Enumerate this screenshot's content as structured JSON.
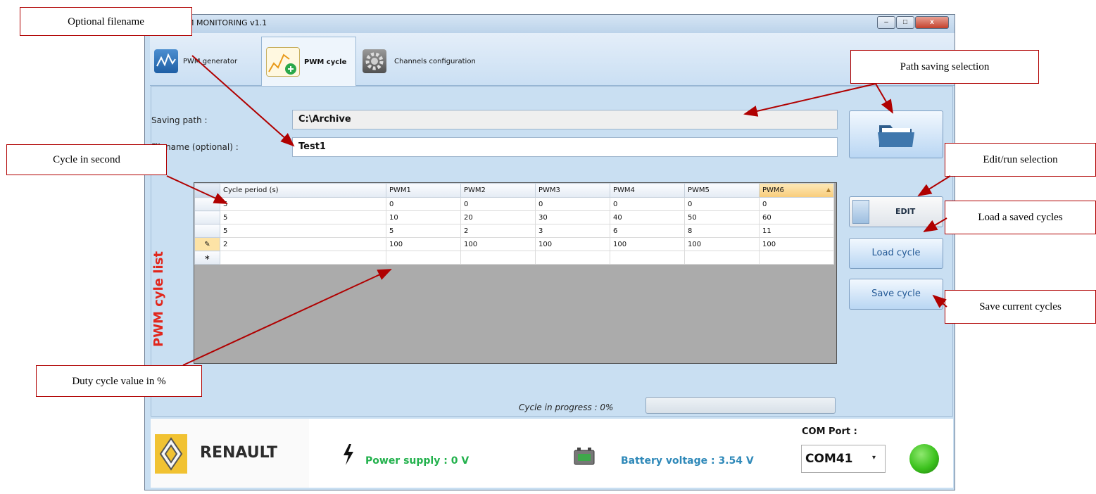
{
  "window": {
    "title": "M MONITORING v1.1",
    "controls": {
      "minimize": "–",
      "maximize": "□",
      "close": "x"
    }
  },
  "tabs": [
    {
      "label": "PWM generator",
      "icon": "waveform-icon"
    },
    {
      "label": "PWM cycle",
      "icon": "chart-add-icon",
      "active": true
    },
    {
      "label": "Channels configuration",
      "icon": "gear-icon"
    }
  ],
  "form": {
    "saving_path_label": "Saving path :",
    "saving_path_value": "C:\\Archive",
    "filename_label": "Filename (optional) :",
    "filename_value": "Test1"
  },
  "side_buttons": {
    "folder": "folder-icon",
    "edit": "EDIT",
    "load": "Load cycle",
    "save": "Save cycle"
  },
  "section_label": "PWM cyle list",
  "table": {
    "columns": [
      "Cycle period (s)",
      "PWM1",
      "PWM2",
      "PWM3",
      "PWM4",
      "PWM5",
      "PWM6"
    ],
    "rows": [
      [
        "5",
        "0",
        "0",
        "0",
        "0",
        "0",
        "0"
      ],
      [
        "5",
        "10",
        "20",
        "30",
        "40",
        "50",
        "60"
      ],
      [
        "5",
        "5",
        "2",
        "3",
        "6",
        "8",
        "11"
      ],
      [
        "2",
        "100",
        "100",
        "100",
        "100",
        "100",
        "100"
      ]
    ],
    "new_row_marker": "∗",
    "edit_row_marker": "✎"
  },
  "progress": {
    "label": "Cycle in progress : 0%",
    "value": 0
  },
  "bottom": {
    "brand": "RENAULT",
    "power_supply": "Power supply : 0 V",
    "battery": "Battery voltage : 3.54 V",
    "com_label": "COM Port :",
    "com_value": "COM41",
    "colors": {
      "power": "#22b14c",
      "battery": "#2f89b9",
      "status_led": "#3cc21e"
    }
  },
  "annotations": {
    "optional_filename": "Optional filename",
    "path_saving": "Path saving selection",
    "cycle_in_second": "Cycle in second",
    "edit_run": "Edit/run selection",
    "load_saved": "Load a saved cycles",
    "save_current": "Save current cycles",
    "duty_cycle": "Duty cycle value in %"
  }
}
